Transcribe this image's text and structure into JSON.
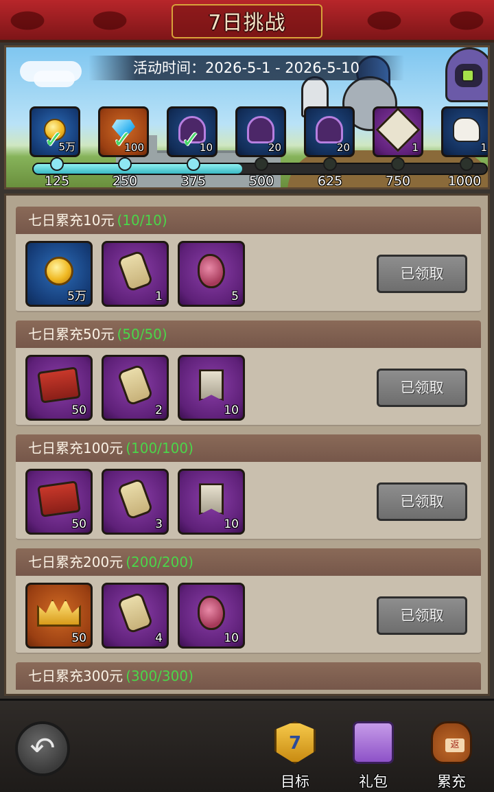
{
  "header": {
    "title": "7日挑战"
  },
  "banner": {
    "activity_time": "活动时间：2026-5-1 - 2026-5-10",
    "milestone_rewards": [
      {
        "icon": "gold-coin-icon",
        "count": "5万",
        "claimed": true,
        "color": "blue"
      },
      {
        "icon": "diamond-icon",
        "count": "100",
        "claimed": true,
        "color": "orange"
      },
      {
        "icon": "purple-hood-icon",
        "count": "10",
        "claimed": true,
        "color": "darkblue"
      },
      {
        "icon": "purple-hood-icon",
        "count": "20",
        "claimed": false,
        "color": "darkblue"
      },
      {
        "icon": "purple-hood-icon",
        "count": "20",
        "claimed": false,
        "color": "darkblue"
      },
      {
        "icon": "compass-icon",
        "count": "1",
        "claimed": false,
        "color": "purple"
      },
      {
        "icon": "horse-icon",
        "count": "1",
        "claimed": false,
        "color": "darkblue"
      }
    ],
    "milestones": [
      "125",
      "250",
      "375",
      "500",
      "625",
      "750",
      "1000"
    ],
    "progress_reached": 3
  },
  "recharge_rows": [
    {
      "title": "七日累充10元",
      "progress": "(10/10)",
      "button": "已领取",
      "items": [
        {
          "icon": "gold-coin-icon",
          "count": "5万",
          "color": "blue"
        },
        {
          "icon": "scroll-icon",
          "count": "1",
          "color": "purple"
        },
        {
          "icon": "rune-stone-icon",
          "count": "5",
          "color": "purple"
        }
      ]
    },
    {
      "title": "七日累充50元",
      "progress": "(50/50)",
      "button": "已领取",
      "items": [
        {
          "icon": "red-book-icon",
          "count": "50",
          "color": "purple"
        },
        {
          "icon": "scroll-icon",
          "count": "2",
          "color": "purple"
        },
        {
          "icon": "banner-flag-icon",
          "count": "10",
          "color": "purple"
        }
      ]
    },
    {
      "title": "七日累充100元",
      "progress": "(100/100)",
      "button": "已领取",
      "items": [
        {
          "icon": "red-book-icon",
          "count": "50",
          "color": "purple"
        },
        {
          "icon": "scroll-icon",
          "count": "3",
          "color": "purple"
        },
        {
          "icon": "banner-flag-icon",
          "count": "10",
          "color": "purple"
        }
      ]
    },
    {
      "title": "七日累充200元",
      "progress": "(200/200)",
      "button": "已领取",
      "items": [
        {
          "icon": "crown-icon",
          "count": "50",
          "color": "orange"
        },
        {
          "icon": "scroll-icon",
          "count": "4",
          "color": "purple"
        },
        {
          "icon": "rune-stone-icon",
          "count": "10",
          "color": "purple"
        }
      ]
    },
    {
      "title": "七日累充300元",
      "progress": "(300/300)"
    }
  ],
  "bottom_nav": {
    "tabs": [
      {
        "label": "目标",
        "icon": "seven-badge-icon",
        "badge_text": "7"
      },
      {
        "label": "礼包",
        "icon": "gift-box-icon"
      },
      {
        "label": "累充",
        "icon": "coin-bag-icon",
        "badge_text": "返"
      }
    ]
  },
  "colors": {
    "progress_text": "#4bd64a",
    "title_bar": "#a81f24",
    "claimed_button": "#7e7e7e"
  }
}
